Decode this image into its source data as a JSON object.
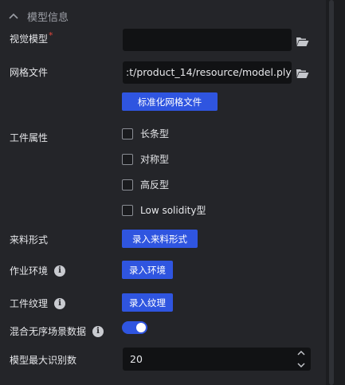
{
  "section": {
    "title": "模型信息"
  },
  "fields": {
    "visual_model": {
      "label": "视觉模型",
      "required_mark": "*",
      "value": ""
    },
    "mesh_file": {
      "label": "网格文件",
      "value": ":t/product_14/resource/model.ply",
      "button": "标准化网格文件"
    },
    "workpiece_props": {
      "label": "工件属性",
      "options": [
        {
          "label": "长条型",
          "checked": false
        },
        {
          "label": "对称型",
          "checked": false
        },
        {
          "label": "高反型",
          "checked": false
        },
        {
          "label": "Low solidity型",
          "checked": false
        }
      ]
    },
    "feed_form": {
      "label": "来料形式",
      "button": "录入来料形式"
    },
    "work_env": {
      "label": "作业环境",
      "button": "录入环境"
    },
    "texture": {
      "label": "工件纹理",
      "button": "录入纹理"
    },
    "mixed_data": {
      "label": "混合无序场景数据",
      "enabled": true
    },
    "max_recognition": {
      "label": "模型最大识别数",
      "value": "20"
    }
  },
  "colors": {
    "accent": "#2f55e0",
    "field_bg": "#111214",
    "panel_bg": "#242529"
  },
  "icons": [
    "chevron-up-icon",
    "folder-open-icon",
    "info-icon",
    "stepper-up-icon",
    "stepper-down-icon"
  ]
}
